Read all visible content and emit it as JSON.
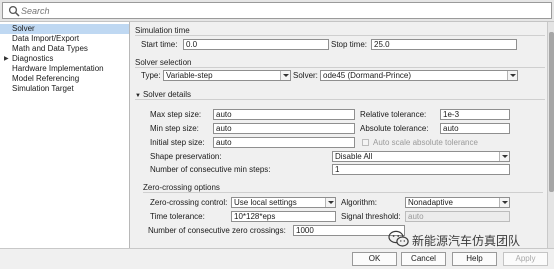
{
  "search": {
    "placeholder": "Search"
  },
  "tree": {
    "items": [
      {
        "label": "Solver",
        "selected": true,
        "expandable": false
      },
      {
        "label": "Data Import/Export",
        "selected": false,
        "expandable": false
      },
      {
        "label": "Math and Data Types",
        "selected": false,
        "expandable": false
      },
      {
        "label": "Diagnostics",
        "selected": false,
        "expandable": true
      },
      {
        "label": "Hardware Implementation",
        "selected": false,
        "expandable": false
      },
      {
        "label": "Model Referencing",
        "selected": false,
        "expandable": false
      },
      {
        "label": "Simulation Target",
        "selected": false,
        "expandable": false
      }
    ]
  },
  "simulation_time": {
    "title": "Simulation time",
    "start_label": "Start time:",
    "start_value": "0.0",
    "stop_label": "Stop time:",
    "stop_value": "25.0"
  },
  "solver_selection": {
    "title": "Solver selection",
    "type_label": "Type:",
    "type_value": "Variable-step",
    "solver_label": "Solver:",
    "solver_value": "ode45 (Dormand-Prince)"
  },
  "solver_details": {
    "title": "Solver details",
    "max_step_label": "Max step size:",
    "max_step_value": "auto",
    "rel_tol_label": "Relative tolerance:",
    "rel_tol_value": "1e-3",
    "min_step_label": "Min step size:",
    "min_step_value": "auto",
    "abs_tol_label": "Absolute tolerance:",
    "abs_tol_value": "auto",
    "init_step_label": "Initial step size:",
    "init_step_value": "auto",
    "auto_scale_label": "Auto scale absolute tolerance",
    "shape_label": "Shape preservation:",
    "shape_value": "Disable All",
    "consec_min_label": "Number of consecutive min steps:",
    "consec_min_value": "1"
  },
  "zero_crossing": {
    "title": "Zero-crossing options",
    "control_label": "Zero-crossing control:",
    "control_value": "Use local settings",
    "algorithm_label": "Algorithm:",
    "algorithm_value": "Nonadaptive",
    "time_tol_label": "Time tolerance:",
    "time_tol_value": "10*128*eps",
    "signal_threshold_label": "Signal threshold:",
    "signal_threshold_value": "auto",
    "consec_zc_label": "Number of consecutive zero crossings:",
    "consec_zc_value": "1000"
  },
  "buttons": {
    "ok": "OK",
    "cancel": "Cancel",
    "help": "Help",
    "apply": "Apply"
  },
  "watermark": {
    "text": "新能源汽车仿真团队",
    "icon": "wechat-logo-icon"
  },
  "colors": {
    "selection": "#bfd8f2",
    "panel": "#f0f0f0",
    "field_border": "#8f8f8f"
  }
}
